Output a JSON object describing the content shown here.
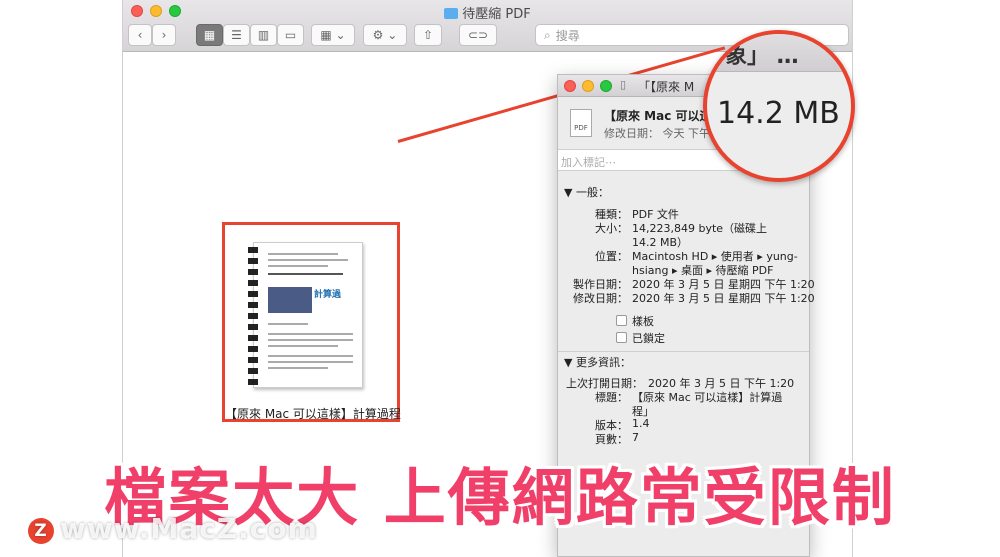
{
  "finder": {
    "title": "待壓縮 PDF",
    "search_placeholder": "搜尋",
    "file_label": "【原來 Mac 可以這樣】計算過程",
    "pdf_heading": "計算過"
  },
  "info": {
    "title": "「【原來 M",
    "name": "【原來 Mac 可以這",
    "modified": "修改日期：  今天 下午",
    "tags_placeholder": "加入標記⋯",
    "general_section": "▼ 一般：",
    "kind_label": "種類：",
    "kind_value": "PDF 文件",
    "size_label": "大小：",
    "size_value1": "14,223,849 byte（磁碟上",
    "size_value2": "14.2 MB）",
    "where_label": "位置：",
    "where_value1": "Macintosh HD ▸ 使用者 ▸ yung-",
    "where_value2": "hsiang ▸ 桌面 ▸ 待壓縮 PDF",
    "created_label": "製作日期：",
    "created_value": "2020 年 3 月 5 日 星期四 下午 1:20",
    "modified_label": "修改日期：",
    "modified_value": "2020 年 3 月 5 日 星期四 下午 1:20",
    "stationery_label": "樣板",
    "locked_label": "已鎖定",
    "more_section": "▼ 更多資訊：",
    "last_opened_label": "上次打開日期：",
    "last_opened_value": "2020 年 3 月 5 日 下午 1:20",
    "doc_title_label": "標題：",
    "doc_title_value1": "【原來 Mac 可以這樣】計算過",
    "doc_title_value2": "程」",
    "version_label": "版本：",
    "version_value": "1.4",
    "pages_label": "頁數：",
    "pages_value": "7"
  },
  "magnifier": {
    "top_text": "象」 …",
    "size": "14.2 MB"
  },
  "headline": "檔案太大 上傳網路常受限制",
  "watermark": {
    "logo": "Z",
    "text": "www.MacZ.com"
  },
  "colors": {
    "highlight": "#e8432f",
    "headline": "#f0406a"
  }
}
